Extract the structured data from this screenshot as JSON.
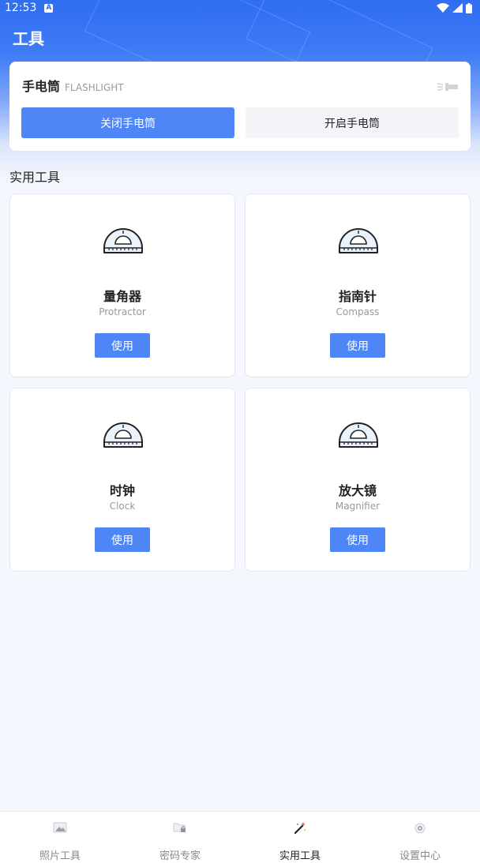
{
  "status_bar": {
    "time": "12:53"
  },
  "header": {
    "title": "工具"
  },
  "flashlight": {
    "title": "手电筒",
    "subtitle": "FLASHLIGHT",
    "off_label": "关闭手电筒",
    "on_label": "开启手电筒",
    "icon": "flashlight-icon"
  },
  "section": {
    "title": "实用工具"
  },
  "tools": [
    {
      "name": "量角器",
      "sub": "Protractor",
      "button": "使用",
      "icon": "protractor-icon"
    },
    {
      "name": "指南针",
      "sub": "Compass",
      "button": "使用",
      "icon": "protractor-icon"
    },
    {
      "name": "时钟",
      "sub": "Clock",
      "button": "使用",
      "icon": "protractor-icon"
    },
    {
      "name": "放大镜",
      "sub": "Magnifier",
      "button": "使用",
      "icon": "protractor-icon"
    }
  ],
  "nav": [
    {
      "label": "照片工具",
      "icon": "image-icon",
      "active": false
    },
    {
      "label": "密码专家",
      "icon": "folder-lock-icon",
      "active": false
    },
    {
      "label": "实用工具",
      "icon": "magic-wand-icon",
      "active": true
    },
    {
      "label": "设置中心",
      "icon": "gear-icon",
      "active": false
    }
  ],
  "colors": {
    "primary": "#4f86f7",
    "header": "#2f6df2"
  }
}
